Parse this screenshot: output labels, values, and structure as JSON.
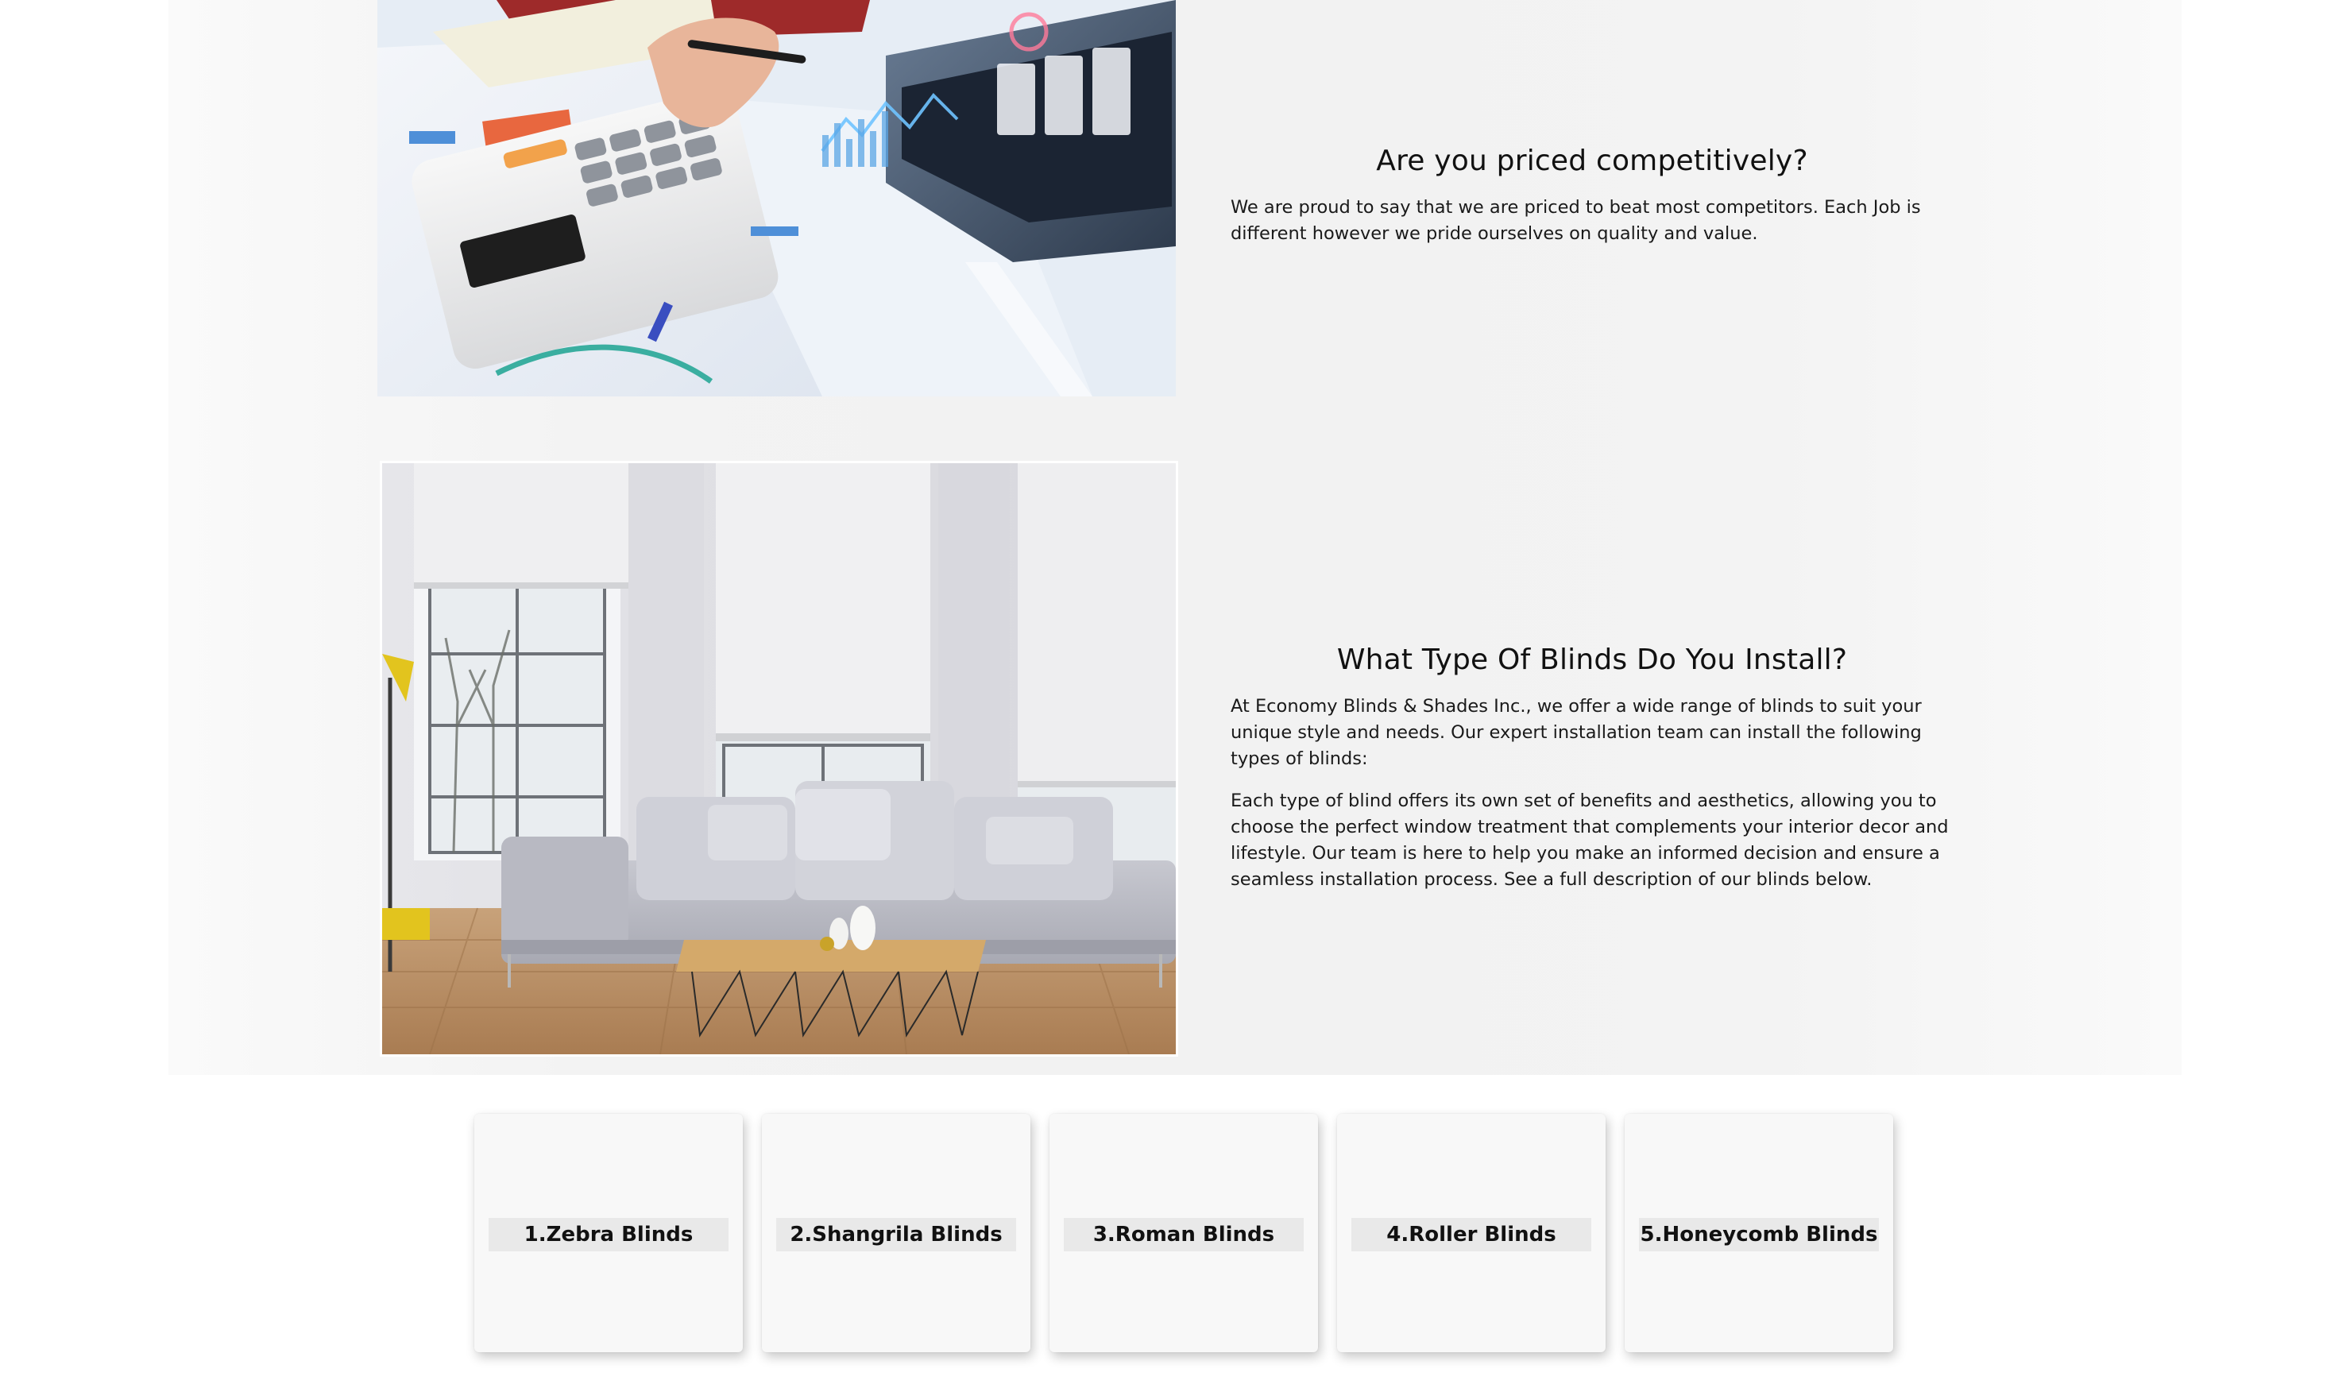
{
  "section_pricing": {
    "heading": "Are you priced competitively?",
    "paragraph": "We are proud to say that we are priced to beat most competitors. Each Job is different however we pride ourselves on quality and value."
  },
  "section_blind_types": {
    "heading": "What Type Of Blinds Do You Install?",
    "paragraph_1": "At Economy Blinds & Shades Inc., we offer a wide range of blinds to suit your unique style and needs. Our expert installation team can install the following types of blinds:",
    "paragraph_2": "Each type of blind offers its own set of benefits and aesthetics, allowing you to choose the perfect window treatment that complements your interior decor and lifestyle. Our team is here to help you make an informed decision and ensure a seamless installation process. See a full description of our blinds below."
  },
  "blind_cards": [
    {
      "label": "1.Zebra Blinds"
    },
    {
      "label": "2.Shangrila Blinds"
    },
    {
      "label": "3.Roman Blinds"
    },
    {
      "label": "4.Roller Blinds"
    },
    {
      "label": "5.Honeycomb Blinds"
    }
  ],
  "colors": {
    "band_background": "#f2f2f2",
    "card_background": "#f8f8f8",
    "card_label_background": "#e9e9e9",
    "text": "#111111"
  }
}
